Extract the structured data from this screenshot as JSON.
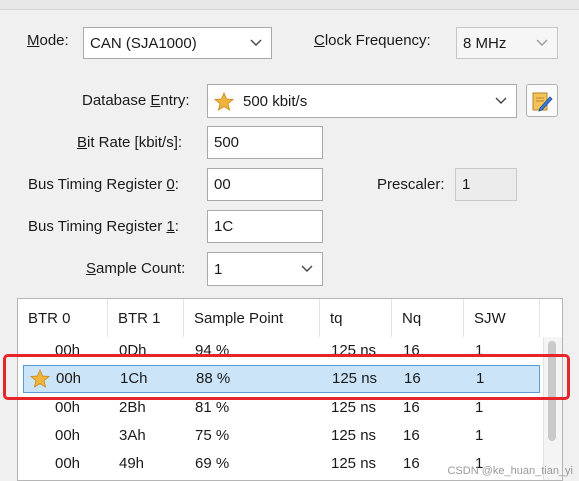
{
  "mode": {
    "label_u": "M",
    "label_rest": "ode:",
    "value": "CAN (SJA1000)"
  },
  "clock": {
    "label_u": "C",
    "label_rest": "lock Frequency:",
    "value": "8 MHz"
  },
  "database": {
    "label_pre": "Database ",
    "label_u": "E",
    "label_rest": "ntry:",
    "value": "500 kbit/s"
  },
  "bitrate": {
    "label_u": "B",
    "label_rest": "it Rate [kbit/s]:",
    "value": "500"
  },
  "btr0": {
    "label_pre": "Bus Timing Register ",
    "label_u": "0",
    "label_rest": ":",
    "value": "00"
  },
  "prescaler": {
    "label": "Prescaler:",
    "value": "1"
  },
  "btr1": {
    "label_pre": "Bus Timing Register ",
    "label_u": "1",
    "label_rest": ":",
    "value": "1C"
  },
  "sample_count": {
    "label_u": "S",
    "label_rest": "ample Count:",
    "value": "1"
  },
  "table": {
    "headers": [
      "BTR 0",
      "BTR 1",
      "Sample Point",
      "tq",
      "Nq",
      "SJW"
    ],
    "rows": [
      [
        "00h",
        "0Dh",
        "94 %",
        "125 ns",
        "16",
        "1"
      ],
      [
        "00h",
        "1Ch",
        "88 %",
        "125 ns",
        "16",
        "1"
      ],
      [
        "00h",
        "2Bh",
        "81 %",
        "125 ns",
        "16",
        "1"
      ],
      [
        "00h",
        "3Ah",
        "75 %",
        "125 ns",
        "16",
        "1"
      ],
      [
        "00h",
        "49h",
        "69 %",
        "125 ns",
        "16",
        "1"
      ]
    ]
  },
  "watermark": "CSDN @ke_huan_tian_yi",
  "colors": {
    "selection": "#cce4f7",
    "highlight": "#e8242b",
    "star": "#f0b43c"
  }
}
